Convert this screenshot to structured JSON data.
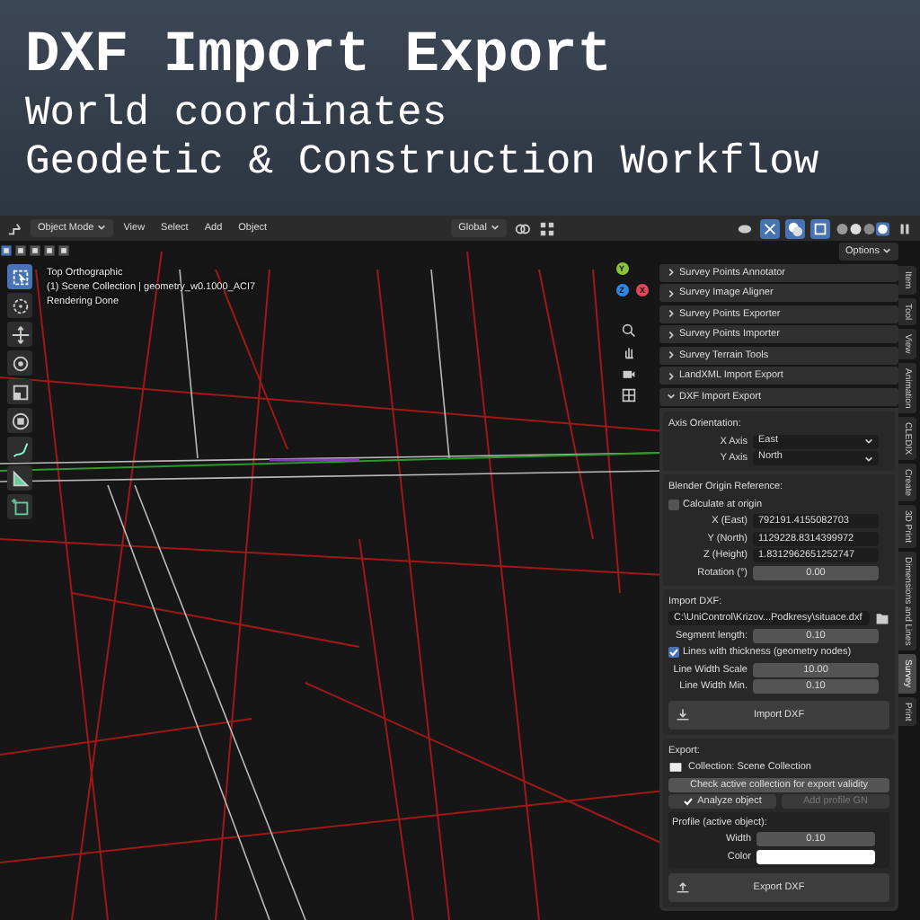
{
  "banner": {
    "title": "DXF Import Export",
    "lines": [
      "World coordinates",
      "Geodetic & Construction Workflow"
    ]
  },
  "topbar": {
    "mode": "Object Mode",
    "menus": [
      "View",
      "Select",
      "Add",
      "Object"
    ],
    "orientation": "Global",
    "options": "Options"
  },
  "viewport": {
    "overlay": [
      "Top Orthographic",
      "(1) Scene Collection | geometry_w0.1000_ACI7",
      "Rendering Done"
    ],
    "gizmo": [
      "Y",
      "Z",
      "X"
    ]
  },
  "tools": [
    {
      "kind": "select",
      "selected": true
    },
    {
      "kind": "cursor",
      "selected": false
    },
    {
      "kind": "move",
      "selected": false
    },
    {
      "kind": "rotate",
      "selected": false
    },
    {
      "kind": "scale",
      "selected": false
    },
    {
      "kind": "transform",
      "selected": false
    },
    {
      "kind": "annotate",
      "selected": false
    },
    {
      "kind": "measure",
      "selected": false
    },
    {
      "kind": "add",
      "selected": false
    }
  ],
  "panels": [
    {
      "title": "Survey Points Annotator",
      "expanded": false
    },
    {
      "title": "Survey Image Aligner",
      "expanded": false
    },
    {
      "title": "Survey Points Exporter",
      "expanded": false
    },
    {
      "title": "Survey Points Importer",
      "expanded": false
    },
    {
      "title": "Survey Terrain Tools",
      "expanded": false
    },
    {
      "title": "LandXML Import Export",
      "expanded": false
    },
    {
      "title": "DXF Import Export",
      "expanded": true
    }
  ],
  "axis": {
    "heading": "Axis Orientation:",
    "rows": [
      {
        "label": "X Axis",
        "value": "East"
      },
      {
        "label": "Y Axis",
        "value": "North"
      }
    ]
  },
  "origin": {
    "heading": "Blender Origin Reference:",
    "checkbox": {
      "label": "Calculate at origin",
      "checked": false
    },
    "fields": [
      {
        "label": "X (East)",
        "value": "792191.4155082703",
        "kind": "text"
      },
      {
        "label": "Y (North)",
        "value": "1129228.8314399972",
        "kind": "text"
      },
      {
        "label": "Z (Height)",
        "value": "1.8312962651252747",
        "kind": "text"
      },
      {
        "label": "Rotation (°)",
        "value": "0.00",
        "kind": "number"
      }
    ]
  },
  "import": {
    "heading": "Import DXF:",
    "path": "C:\\UniControl\\Krizov...Podkresy\\situace.dxf",
    "segment": {
      "label": "Segment length:",
      "value": "0.10"
    },
    "checkbox": {
      "label": "Lines with thickness (geometry nodes)",
      "checked": true
    },
    "fields": [
      {
        "label": "Line Width Scale",
        "value": "10.00"
      },
      {
        "label": "Line Width Min.",
        "value": "0.10"
      }
    ],
    "button": "Import DXF"
  },
  "export": {
    "heading": "Export:",
    "collection": "Collection: Scene Collection",
    "check_button": "Check active collection for export validity",
    "analyze": {
      "label": "Analyze object",
      "checked": true
    },
    "profile_button": {
      "label": "Add profile GN",
      "disabled": true
    },
    "profile": {
      "heading": "Profile (active object):",
      "width": {
        "label": "Width",
        "value": "0.10"
      },
      "color": {
        "label": "Color",
        "color": "#ffffff"
      }
    },
    "button": "Export DXF"
  },
  "tabs": [
    {
      "label": "Item",
      "selected": false
    },
    {
      "label": "Tool",
      "selected": false
    },
    {
      "label": "View",
      "selected": false
    },
    {
      "label": "Animation",
      "selected": false
    },
    {
      "label": "CLEDIX",
      "selected": false
    },
    {
      "label": "Create",
      "selected": false
    },
    {
      "label": "3D Print",
      "selected": false
    },
    {
      "label": "Dimensions and Lines",
      "selected": false
    },
    {
      "label": "Survey",
      "selected": true
    },
    {
      "label": "Print",
      "selected": false
    }
  ]
}
